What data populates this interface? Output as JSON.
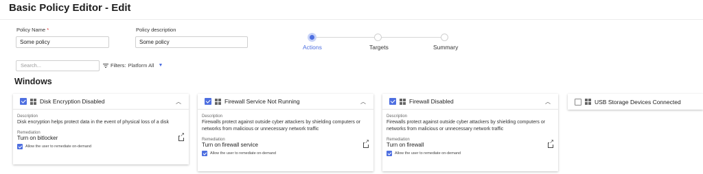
{
  "header": {
    "title": "Basic Policy Editor - Edit"
  },
  "form": {
    "policy_name_label": "Policy Name",
    "required_mark": "*",
    "policy_name_value": "Some policy",
    "policy_description_label": "Policy description",
    "policy_description_value": "Some policy"
  },
  "stepper": {
    "steps": [
      {
        "label": "Actions",
        "state": "active"
      },
      {
        "label": "Targets",
        "state": "inactive"
      },
      {
        "label": "Summary",
        "state": "inactive"
      }
    ]
  },
  "toolbar": {
    "search_placeholder": "Search...",
    "filters_label": "Filters:",
    "filter_value": "Platform All"
  },
  "section": {
    "title": "Windows"
  },
  "cards": [
    {
      "title": "Disk Encryption Disabled",
      "checked": true,
      "expanded": true,
      "description_label": "Description",
      "description": "Disk encryption helps protect data in the event of physical loss of a disk",
      "remediation_label": "Remediation",
      "remediation": "Turn on bitlocker",
      "ondemand_label": "Allow the user to remediate on-demand",
      "ondemand_checked": true
    },
    {
      "title": "Firewall Service Not Running",
      "checked": true,
      "expanded": true,
      "description_label": "Description",
      "description": "Firewalls protect against outside cyber attackers by shielding computers or networks from malicious or unnecessary network traffic",
      "remediation_label": "Remediation",
      "remediation": "Turn on firewall service",
      "ondemand_label": "Allow the user to remediate on-demand",
      "ondemand_checked": true
    },
    {
      "title": "Firewall Disabled",
      "checked": true,
      "expanded": true,
      "description_label": "Description",
      "description": "Firewalls protect against outside cyber attackers by shielding computers or networks from malicious or unnecessary network traffic",
      "remediation_label": "Remediation",
      "remediation": "Turn on firewall",
      "ondemand_label": "Allow the user to remediate on-demand",
      "ondemand_checked": true
    },
    {
      "title": "USB Storage Devices Connected",
      "checked": false,
      "expanded": false
    }
  ],
  "colors": {
    "accent": "#4e6fe0",
    "required": "#dd3333",
    "border": "#cfcfcf"
  },
  "icons": {
    "platform": "windows-icon",
    "collapse": "chevron-up-icon",
    "open_external": "external-link-icon",
    "dropdown": "caret-down-icon"
  }
}
